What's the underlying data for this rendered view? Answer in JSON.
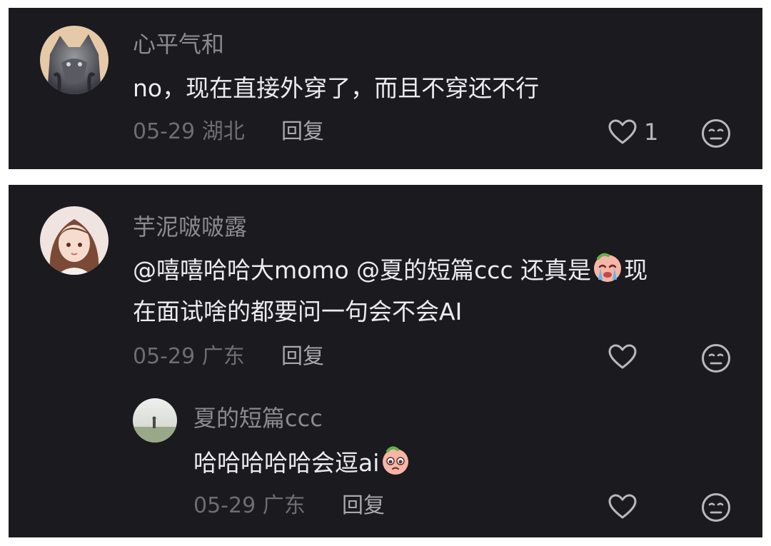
{
  "comments": [
    {
      "username": "心平气和",
      "text": "no，现在直接外穿了，而且不穿还不行",
      "date": "05-29",
      "location": "湖北",
      "reply_label": "回复",
      "like_count": "1",
      "avatar_icon": "wolf-avatar",
      "like_icon": "heart-outline-icon",
      "dislike_icon": "meh-face-icon"
    },
    {
      "username": "芋泥啵啵露",
      "text_line1_prefix": "@嘻嘻哈哈大momo @夏的短篇ccc 还真是",
      "text_line1_suffix": "现",
      "text_line2": "在面试啥的都要问一句会不会AI",
      "emoji_icon": "crying-face-emoji",
      "date": "05-29",
      "location": "广东",
      "reply_label": "回复",
      "avatar_icon": "anime-girl-avatar",
      "like_icon": "heart-outline-icon",
      "dislike_icon": "meh-face-icon"
    }
  ],
  "replies": [
    {
      "username": "夏的短篇ccc",
      "text": "哈哈哈哈哈会逗ai",
      "emoji_icon": "pleading-face-emoji",
      "date": "05-29",
      "location": "广东",
      "reply_label": "回复",
      "avatar_icon": "landscape-avatar",
      "like_icon": "heart-outline-icon",
      "dislike_icon": "meh-face-icon"
    }
  ],
  "colors": {
    "panel_bg": "#1a1a1f",
    "username": "#8a8a90",
    "content": "#ececee",
    "meta": "#6d6d73"
  }
}
